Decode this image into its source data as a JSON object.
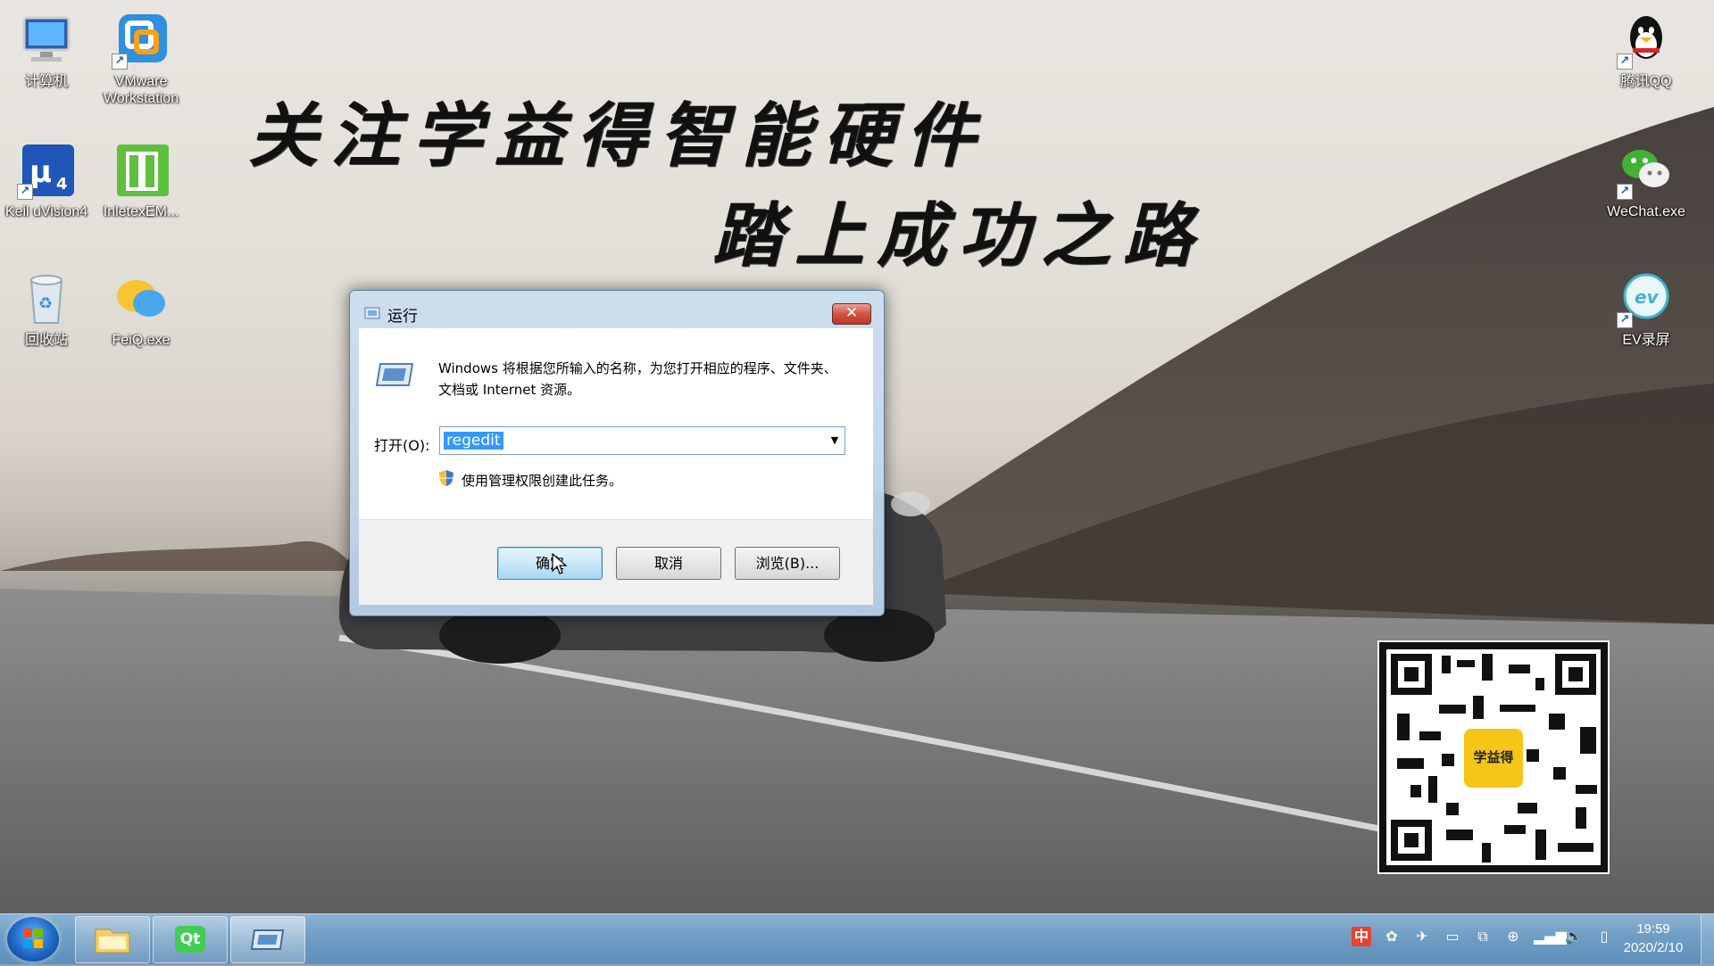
{
  "desktop": {
    "icons_left": [
      {
        "label": "计算机"
      },
      {
        "label": "VMware Workstation"
      },
      {
        "label": "Keil uVision4"
      },
      {
        "label": "InletexEM..."
      },
      {
        "label": "回收站"
      },
      {
        "label": "FeiQ.exe"
      }
    ],
    "icons_right": [
      {
        "label": "腾讯QQ"
      },
      {
        "label": "WeChat.exe"
      },
      {
        "label": "EV录屏"
      }
    ],
    "slogan_line1": "关注学益得智能硬件",
    "slogan_line2": "踏上成功之路",
    "qr_logo_text": "学益得"
  },
  "run_dialog": {
    "title": "运行",
    "close_symbol": "✕",
    "description": "Windows 将根据您所输入的名称，为您打开相应的程序、文件夹、文档或 Internet 资源。",
    "open_label": "打开(O):",
    "open_value": "regedit",
    "admin_note": "使用管理权限创建此任务。",
    "ok_label": "确定",
    "cancel_label": "取消",
    "browse_label": "浏览(B)..."
  },
  "taskbar": {
    "ime_indicator": "中",
    "clock_time": "19:59",
    "clock_date": "2020/2/10",
    "qt_label": "Qt"
  }
}
